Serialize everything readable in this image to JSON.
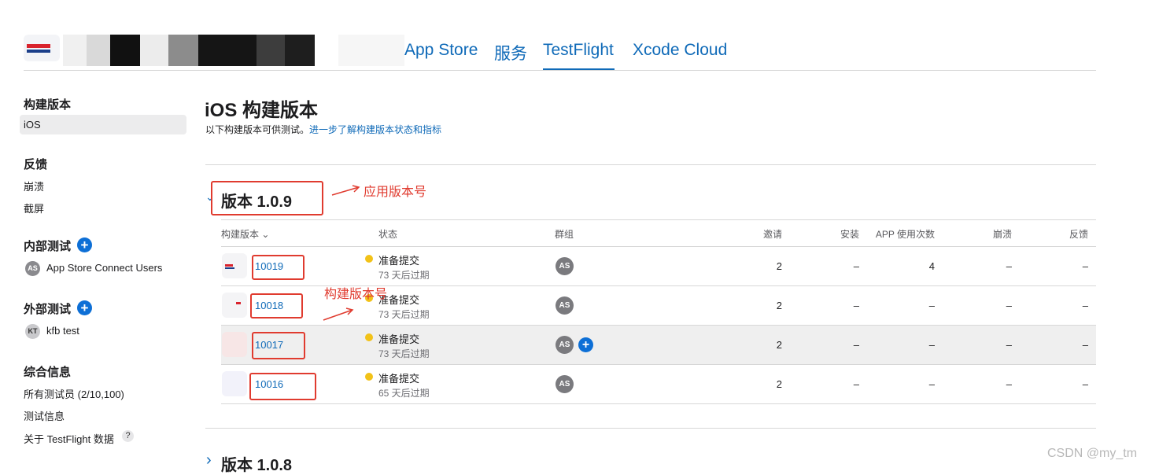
{
  "header": {
    "tabs": [
      {
        "label": "App Store"
      },
      {
        "label": "服务"
      },
      {
        "label": "TestFlight"
      },
      {
        "label": "Xcode Cloud"
      }
    ],
    "active_tab": "TestFlight"
  },
  "sidebar": {
    "builds_title": "构建版本",
    "builds_ios": "iOS",
    "feedback_title": "反馈",
    "feedback_crashes": "崩溃",
    "feedback_screenshots": "截屏",
    "internal_title": "内部测试",
    "internal_group": {
      "initials": "AS",
      "label": "App Store Connect Users"
    },
    "external_title": "外部测试",
    "external_group": {
      "initials": "KT",
      "label": "kfb test"
    },
    "general_title": "综合信息",
    "general_testers": "所有测试员 (2/10,100)",
    "general_test_info": "测试信息",
    "general_about": "关于 TestFlight 数据",
    "help_glyph": "?"
  },
  "main": {
    "title": "iOS 构建版本",
    "subtitle": "以下构建版本可供测试。",
    "subtitle_link": "进一步了解构建版本状态和指标",
    "version_open": {
      "chevron": "⌄",
      "title": "版本 1.0.9"
    },
    "version_closed": {
      "chevron": "›",
      "title": "版本 1.0.8"
    },
    "columns": {
      "build": "构建版本",
      "sort_glyph": "⌄",
      "status": "状态",
      "groups": "群组",
      "invites": "邀请",
      "installs": "安装",
      "app_uses": "APP 使用次数",
      "crashes": "崩溃",
      "feedback": "反馈"
    },
    "rows": [
      {
        "build": "10019",
        "status": "准备提交",
        "expires": "73 天后过期",
        "group": "AS",
        "invites": "2",
        "installs": "–",
        "uses": "4",
        "crashes": "–",
        "feedback": "–"
      },
      {
        "build": "10018",
        "status": "准备提交",
        "expires": "73 天后过期",
        "group": "AS",
        "invites": "2",
        "installs": "–",
        "uses": "–",
        "crashes": "–",
        "feedback": "–"
      },
      {
        "build": "10017",
        "status": "准备提交",
        "expires": "73 天后过期",
        "group": "AS",
        "invites": "2",
        "installs": "–",
        "uses": "–",
        "crashes": "–",
        "feedback": "–"
      },
      {
        "build": "10016",
        "status": "准备提交",
        "expires": "65 天后过期",
        "group": "AS",
        "invites": "2",
        "installs": "–",
        "uses": "–",
        "crashes": "–",
        "feedback": "–"
      }
    ],
    "row_add_glyph": "+"
  },
  "annotations": {
    "version_note": "应用版本号",
    "build_note": "构建版本号"
  },
  "watermark": "CSDN @my_tm",
  "colors": {
    "link_blue": "#0f6ab8",
    "accent_blue": "#0d6fd6",
    "status_yellow": "#f2c218",
    "annotation_red": "#e03b2f",
    "selected_row": "#efefef"
  }
}
